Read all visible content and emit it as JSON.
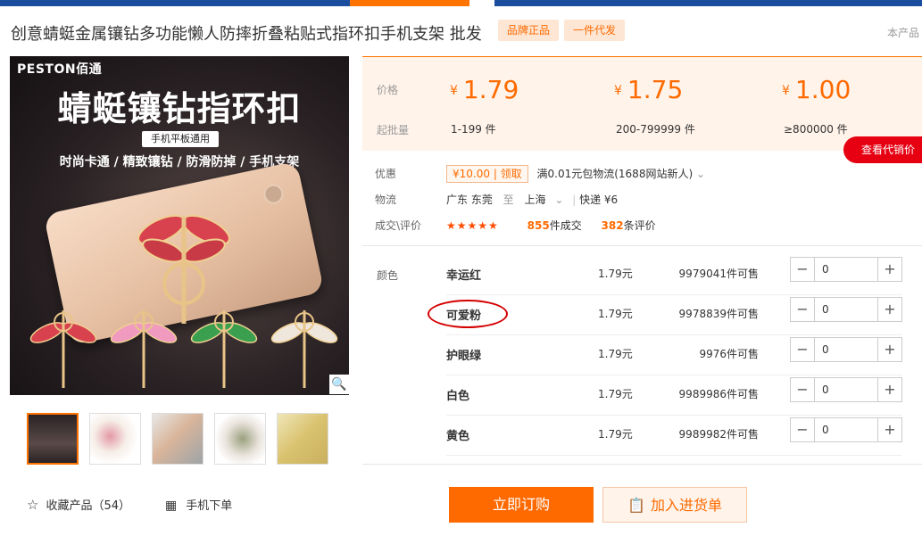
{
  "header": {
    "title": "创意蜻蜓金属镶钻多功能懒人防摔折叠粘贴式指环扣手机支架 批发",
    "tags": [
      "品牌正品",
      "一件代发"
    ],
    "corner_text": "本产品"
  },
  "gallery": {
    "brand": "PESTON佰通",
    "headline": "蜻蜓镶钻指环扣",
    "badge": "手机平板通用",
    "slogan": "时尚卡通 / 精致镶钻 / 防滑防掉 / 手机支架",
    "zoom_icon": "🔍",
    "thumbnail_count": 5
  },
  "actions": {
    "favorite_label": "收藏产品（54）",
    "mobile_label": "手机下单"
  },
  "pricing": {
    "price_label": "价格",
    "batch_label": "起批量",
    "tiers": [
      {
        "price": "1.79",
        "batch": "1-199 件"
      },
      {
        "price": "1.75",
        "batch": "200-799999 件"
      },
      {
        "price": "1.00",
        "batch": "≥800000 件"
      }
    ],
    "currency": "¥",
    "agent_button": "查看代销价"
  },
  "info": {
    "promo_label": "优惠",
    "coupon_amount": "¥10.00",
    "coupon_action": "领取",
    "promo_text": "满0.01元包物流(1688网站新人)",
    "shipping_label": "物流",
    "ship_from": "广东 东莞",
    "ship_to_word": "至",
    "ship_to": "上海",
    "express": "快递 ¥6",
    "review_label": "成交\\评价",
    "stars": "★★★★★",
    "deals_count": "855",
    "deals_label": "件成交",
    "reviews_count": "382",
    "reviews_label": "条评价"
  },
  "sku": {
    "label": "颜色",
    "items": [
      {
        "name": "幸运红",
        "price": "1.79元",
        "stock": "9979041件可售",
        "qty": "0"
      },
      {
        "name": "可爱粉",
        "price": "1.79元",
        "stock": "9978839件可售",
        "qty": "0"
      },
      {
        "name": "护眼绿",
        "price": "1.79元",
        "stock": "9976件可售",
        "qty": "0"
      },
      {
        "name": "白色",
        "price": "1.79元",
        "stock": "9989986件可售",
        "qty": "0"
      },
      {
        "name": "黄色",
        "price": "1.79元",
        "stock": "9989982件可售",
        "qty": "0"
      }
    ]
  },
  "buttons": {
    "buy": "立即订购",
    "cart": "加入进货单"
  },
  "colors": {
    "accent": "#ff6a00",
    "topbar": "#1a4d9e",
    "red_button": "#e60012"
  }
}
